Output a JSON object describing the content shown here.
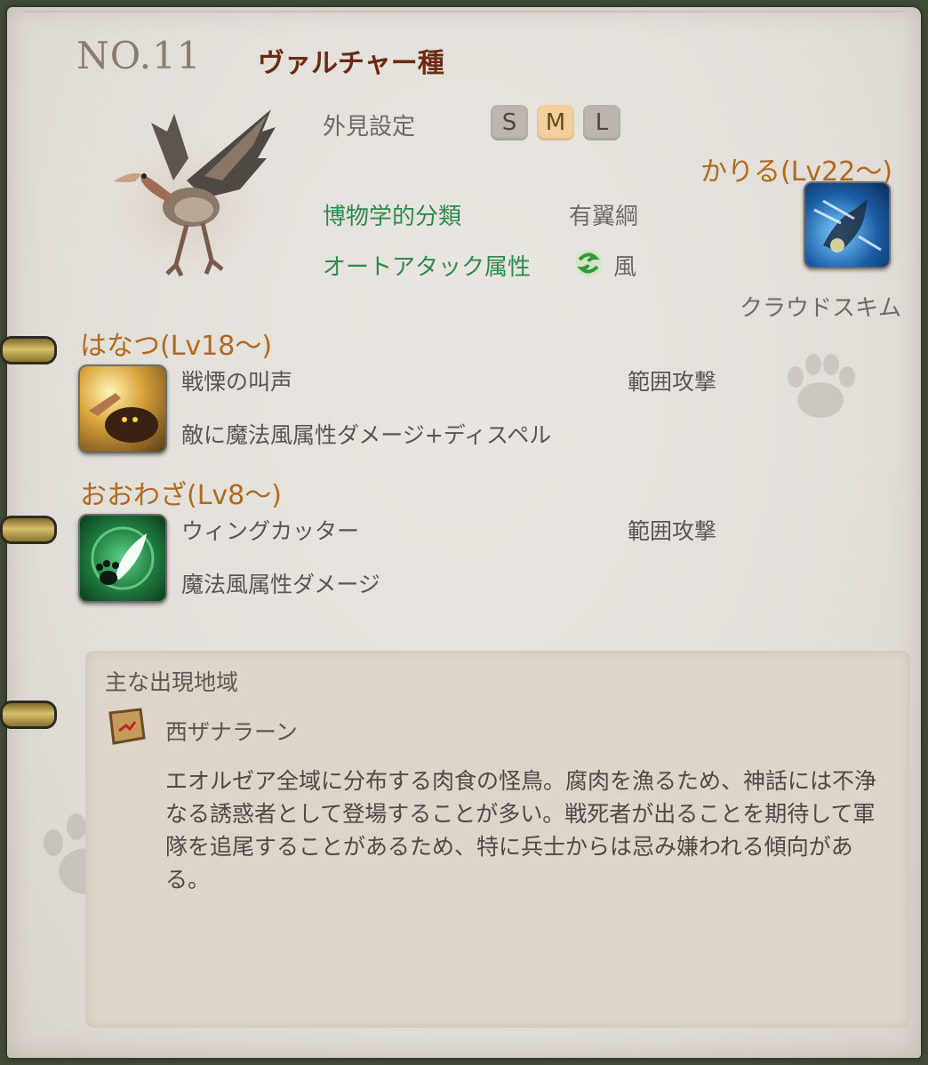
{
  "header": {
    "number": "NO.11",
    "species": "ヴァルチャー種"
  },
  "appearance": {
    "label": "外見設定",
    "sizes": [
      "S",
      "M",
      "L"
    ],
    "selected": "M"
  },
  "classification": {
    "label": "博物学的分類",
    "value": "有翼綱"
  },
  "auto_attack": {
    "label": "オートアタック属性",
    "value": "風",
    "icon": "wind-element-icon"
  },
  "borrow": {
    "heading": "かりる(Lv22～)",
    "skill_name": "クラウドスキム",
    "icon": "cloud-skim-icon"
  },
  "release": {
    "heading": "はなつ(Lv18～)",
    "skill_name": "戦慄の叫声",
    "type": "範囲攻撃",
    "description": "敵に魔法風属性ダメージ+ディスペル",
    "icon": "battle-cry-icon"
  },
  "big_move": {
    "heading": "おおわざ(Lv8～)",
    "skill_name": "ウィングカッター",
    "type": "範囲攻撃",
    "description": "魔法風属性ダメージ",
    "icon": "wing-cutter-icon"
  },
  "habitat": {
    "label": "主な出現地域",
    "region": "西ザナラーン",
    "icon": "map-scroll-icon",
    "description": "エオルゼア全域に分布する肉食の怪鳥。腐肉を漁るため、神話には不浄なる誘惑者として登場することが多い。戦死者が出ることを期待して軍隊を追尾することがあるため、特に兵士からは忌み嫌われる傾向がある。"
  },
  "colors": {
    "species": "#6b2a14",
    "heading_orange": "#b06a1e",
    "label_green": "#2f8a4e",
    "selected_size": "#f3cf9b"
  }
}
